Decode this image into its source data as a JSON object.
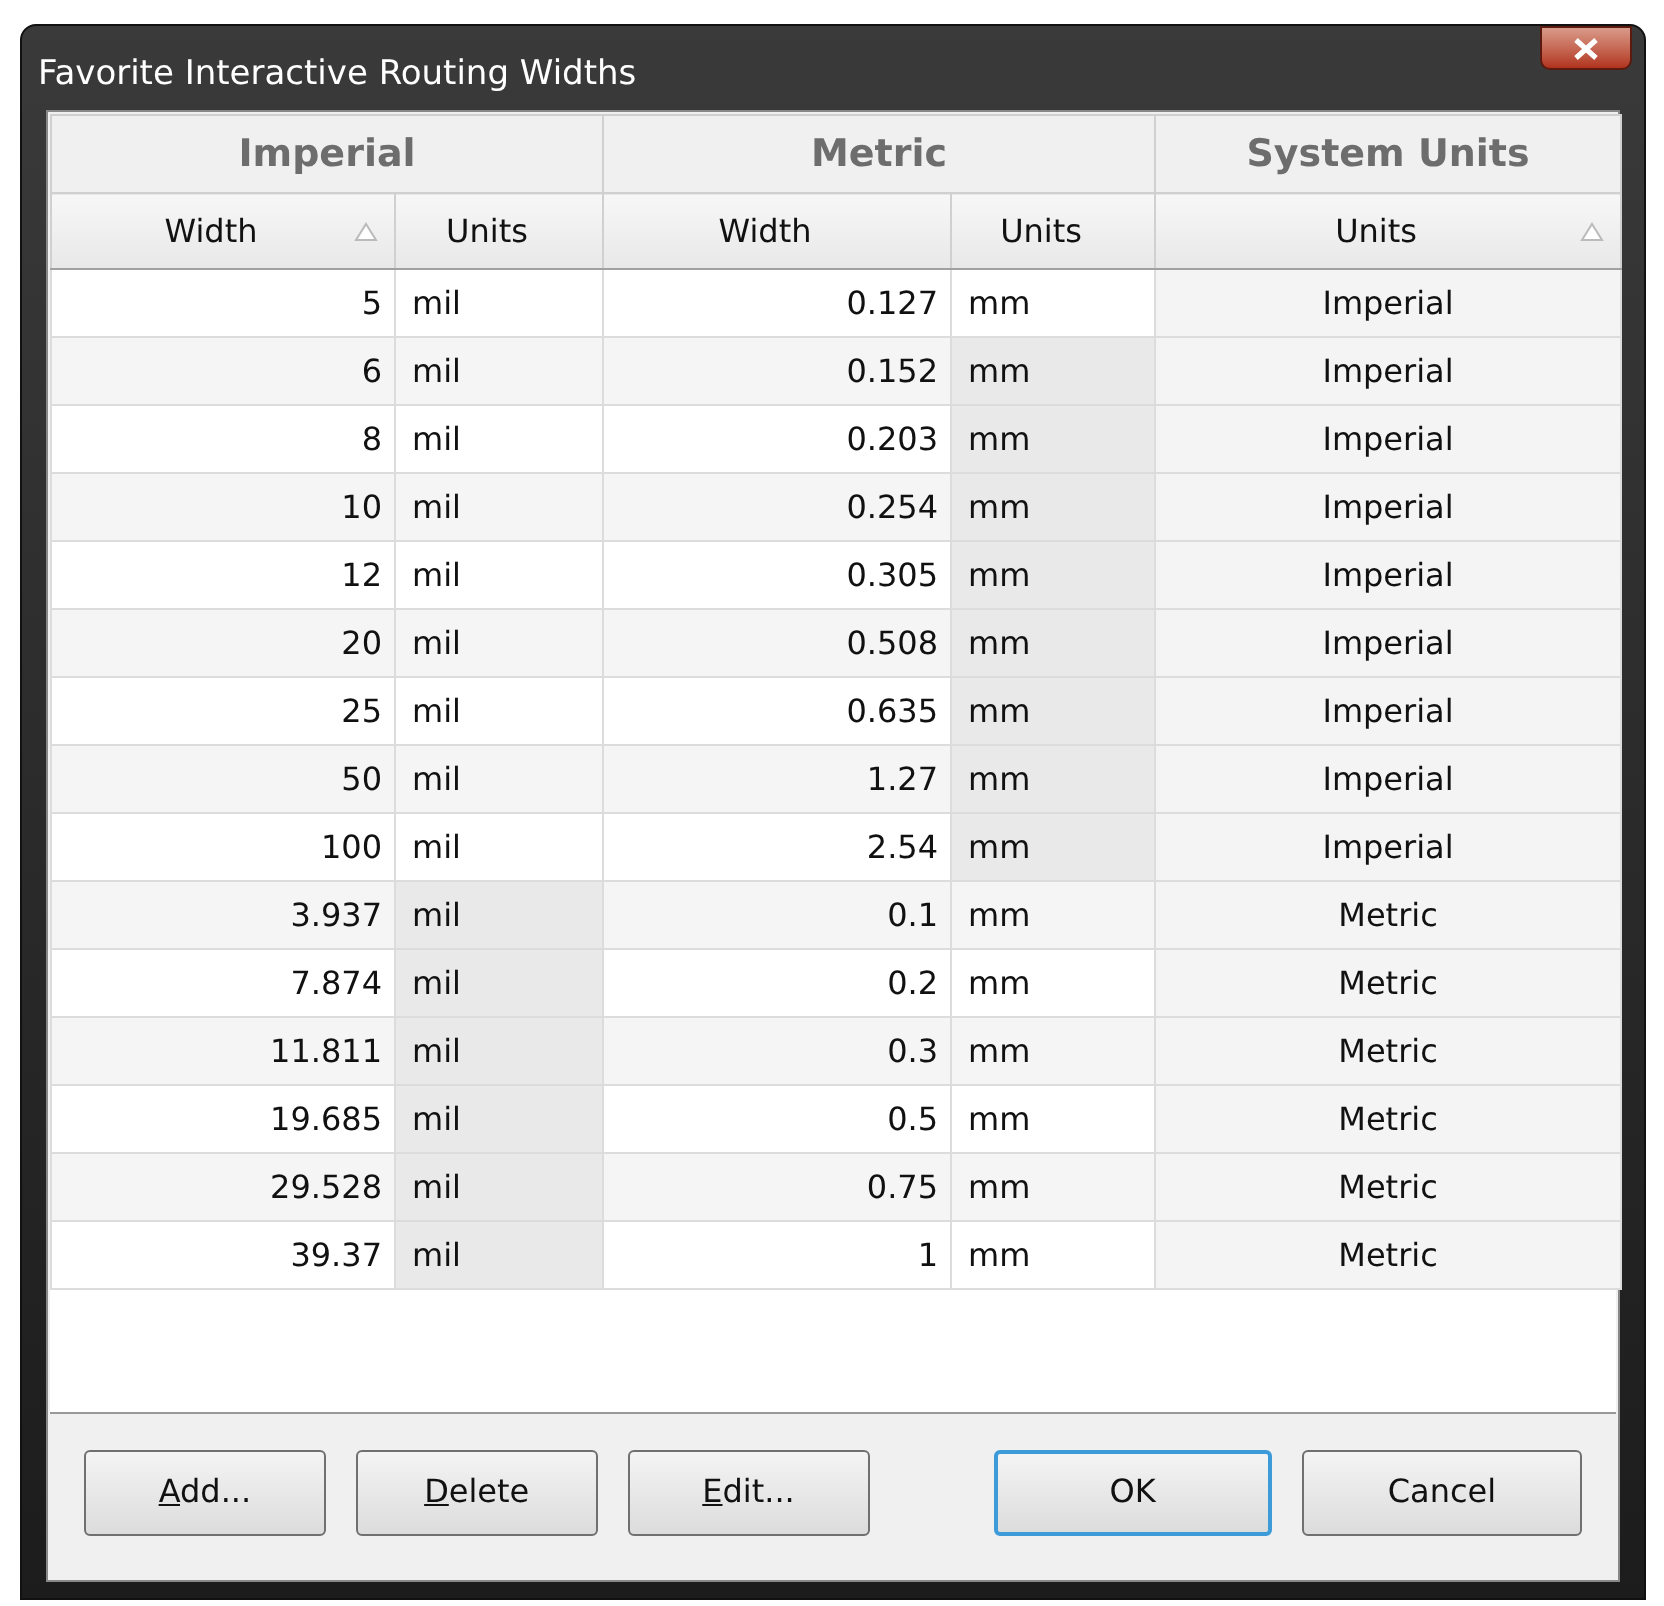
{
  "window": {
    "title": "Favorite Interactive Routing Widths"
  },
  "table": {
    "groups": [
      {
        "label": "Imperial"
      },
      {
        "label": "Metric"
      },
      {
        "label": "System Units"
      }
    ],
    "columns": [
      {
        "label": "Width",
        "sorted": true
      },
      {
        "label": "Units",
        "sorted": false
      },
      {
        "label": "Width",
        "sorted": false
      },
      {
        "label": "Units",
        "sorted": false
      },
      {
        "label": "Units",
        "sorted": true
      }
    ],
    "rows": [
      {
        "selected": true,
        "kind": "imperial",
        "cells": [
          "5",
          "mil",
          "0.127",
          "mm",
          "Imperial"
        ]
      },
      {
        "selected": false,
        "kind": "imperial",
        "cells": [
          "6",
          "mil",
          "0.152",
          "mm",
          "Imperial"
        ]
      },
      {
        "selected": false,
        "kind": "imperial",
        "cells": [
          "8",
          "mil",
          "0.203",
          "mm",
          "Imperial"
        ]
      },
      {
        "selected": false,
        "kind": "imperial",
        "cells": [
          "10",
          "mil",
          "0.254",
          "mm",
          "Imperial"
        ]
      },
      {
        "selected": false,
        "kind": "imperial",
        "cells": [
          "12",
          "mil",
          "0.305",
          "mm",
          "Imperial"
        ]
      },
      {
        "selected": false,
        "kind": "imperial",
        "cells": [
          "20",
          "mil",
          "0.508",
          "mm",
          "Imperial"
        ]
      },
      {
        "selected": false,
        "kind": "imperial",
        "cells": [
          "25",
          "mil",
          "0.635",
          "mm",
          "Imperial"
        ]
      },
      {
        "selected": false,
        "kind": "imperial",
        "cells": [
          "50",
          "mil",
          "1.27",
          "mm",
          "Imperial"
        ]
      },
      {
        "selected": false,
        "kind": "imperial",
        "cells": [
          "100",
          "mil",
          "2.54",
          "mm",
          "Imperial"
        ]
      },
      {
        "selected": false,
        "kind": "metric",
        "cells": [
          "3.937",
          "mil",
          "0.1",
          "mm",
          "Metric"
        ]
      },
      {
        "selected": false,
        "kind": "metric",
        "cells": [
          "7.874",
          "mil",
          "0.2",
          "mm",
          "Metric"
        ]
      },
      {
        "selected": false,
        "kind": "metric",
        "cells": [
          "11.811",
          "mil",
          "0.3",
          "mm",
          "Metric"
        ]
      },
      {
        "selected": false,
        "kind": "metric",
        "cells": [
          "19.685",
          "mil",
          "0.5",
          "mm",
          "Metric"
        ]
      },
      {
        "selected": false,
        "kind": "metric",
        "cells": [
          "29.528",
          "mil",
          "0.75",
          "mm",
          "Metric"
        ]
      },
      {
        "selected": false,
        "kind": "metric",
        "cells": [
          "39.37",
          "mil",
          "1",
          "mm",
          "Metric"
        ]
      }
    ]
  },
  "buttons": [
    {
      "label": "Add...",
      "underline_first": true,
      "default": false
    },
    {
      "label": "Delete",
      "underline_first": true,
      "default": false
    },
    {
      "label": "Edit...",
      "underline_first": true,
      "default": false
    },
    {
      "label": "OK",
      "underline_first": false,
      "default": true
    },
    {
      "label": "Cancel",
      "underline_first": false,
      "default": false
    }
  ]
}
